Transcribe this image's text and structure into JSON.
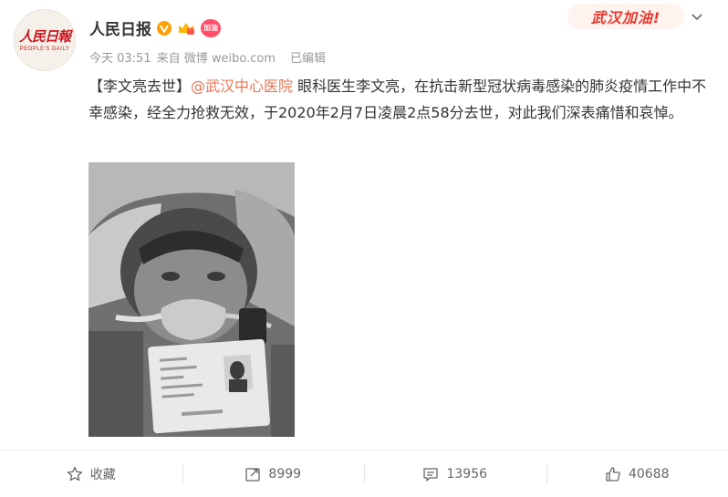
{
  "user": {
    "name": "人民日报",
    "avatar_text": "人民日報",
    "avatar_subtext": "PEOPLE'S DAILY",
    "badge_label": "加油"
  },
  "meta": {
    "time": "今天 03:51",
    "source": "来自 微博 weibo.com",
    "edited": "已编辑"
  },
  "promo_badge": "武汉加油!",
  "post": {
    "tag": "【李文亮去世】",
    "mention": "@武汉中心医院",
    "text": " 眼科医生李文亮，在抗击新型冠状病毒感染的肺炎疫情工作中不幸感染，经全力抢救无效，于2020年2月7日凌晨2点58分去世，对此我们深表痛惜和哀悼。"
  },
  "actions": {
    "favorite": "收藏",
    "repost": "8999",
    "comment": "13956",
    "like": "40688"
  },
  "colors": {
    "mention": "#eb7350",
    "brand_red": "#c8161d",
    "verified": "#ffa000"
  }
}
